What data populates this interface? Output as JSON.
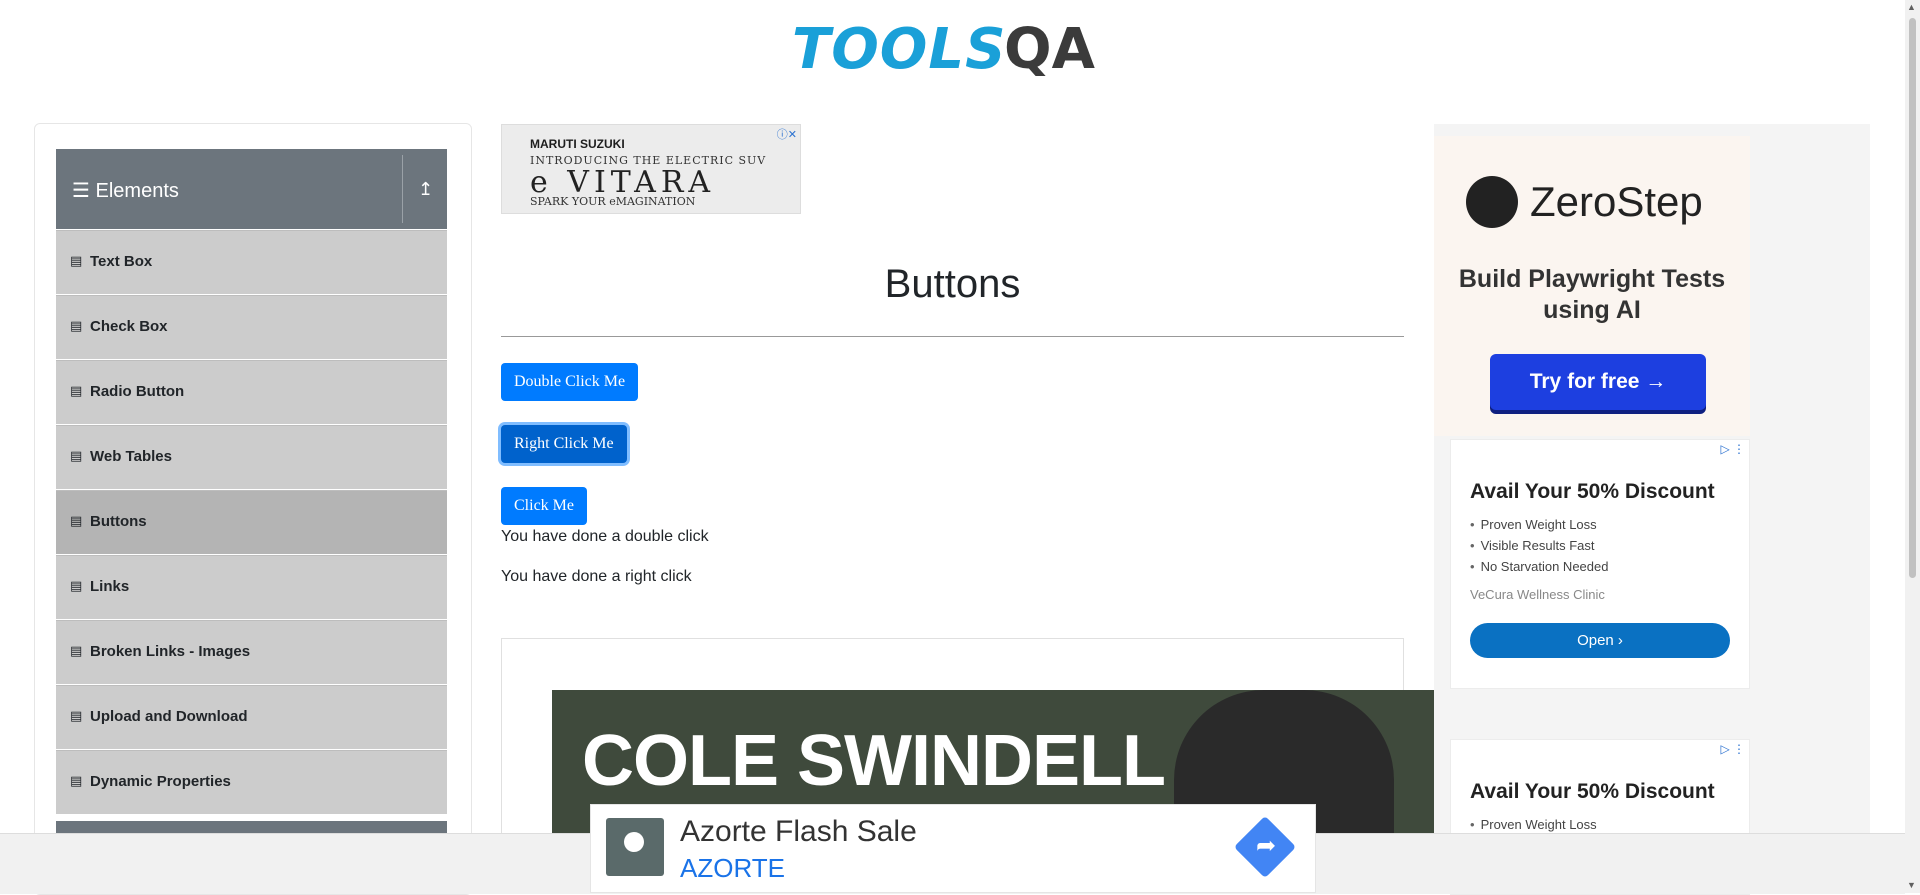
{
  "header": {
    "logo_main": "TOOLS",
    "logo_accent": "QA"
  },
  "sidebar": {
    "group_title": "Elements",
    "items": [
      {
        "label": "Text Box"
      },
      {
        "label": "Check Box"
      },
      {
        "label": "Radio Button"
      },
      {
        "label": "Web Tables"
      },
      {
        "label": "Buttons",
        "active": true
      },
      {
        "label": "Links"
      },
      {
        "label": "Broken Links - Images"
      },
      {
        "label": "Upload and Download"
      },
      {
        "label": "Dynamic Properties"
      }
    ]
  },
  "ad_top": {
    "brand": "MARUTI SUZUKI",
    "line1": "INTRODUCING THE ELECTRIC SUV",
    "line2": "e VITARA",
    "line3": "SPARK YOUR eMAGINATION"
  },
  "main": {
    "title": "Buttons",
    "double_click_label": "Double Click Me",
    "right_click_label": "Right Click Me",
    "click_label": "Click Me",
    "double_click_message": "You have done a double click",
    "right_click_message": "You have done a right click"
  },
  "ad_banner": {
    "text": "COLE SWINDELL"
  },
  "ad_zerostep": {
    "brand": "ZeroStep",
    "tagline": "Build Playwright Tests using AI",
    "cta": "Try for free →"
  },
  "ad_cards": [
    {
      "heading": "Avail Your 50% Discount",
      "bullets": [
        "Proven Weight Loss",
        "Visible Results Fast",
        "No Starvation Needed"
      ],
      "source": "VeCura Wellness Clinic",
      "cta": "Open ›"
    },
    {
      "heading": "Avail Your 50% Discount",
      "bullets": [
        "Proven Weight Loss"
      ]
    }
  ],
  "bottom_ad": {
    "title": "Azorte Flash Sale",
    "brand": "AZORTE"
  },
  "colors": {
    "primary": "#007bff",
    "sidebar_header": "#6c757d",
    "logo_blue": "#1aa0d8"
  }
}
